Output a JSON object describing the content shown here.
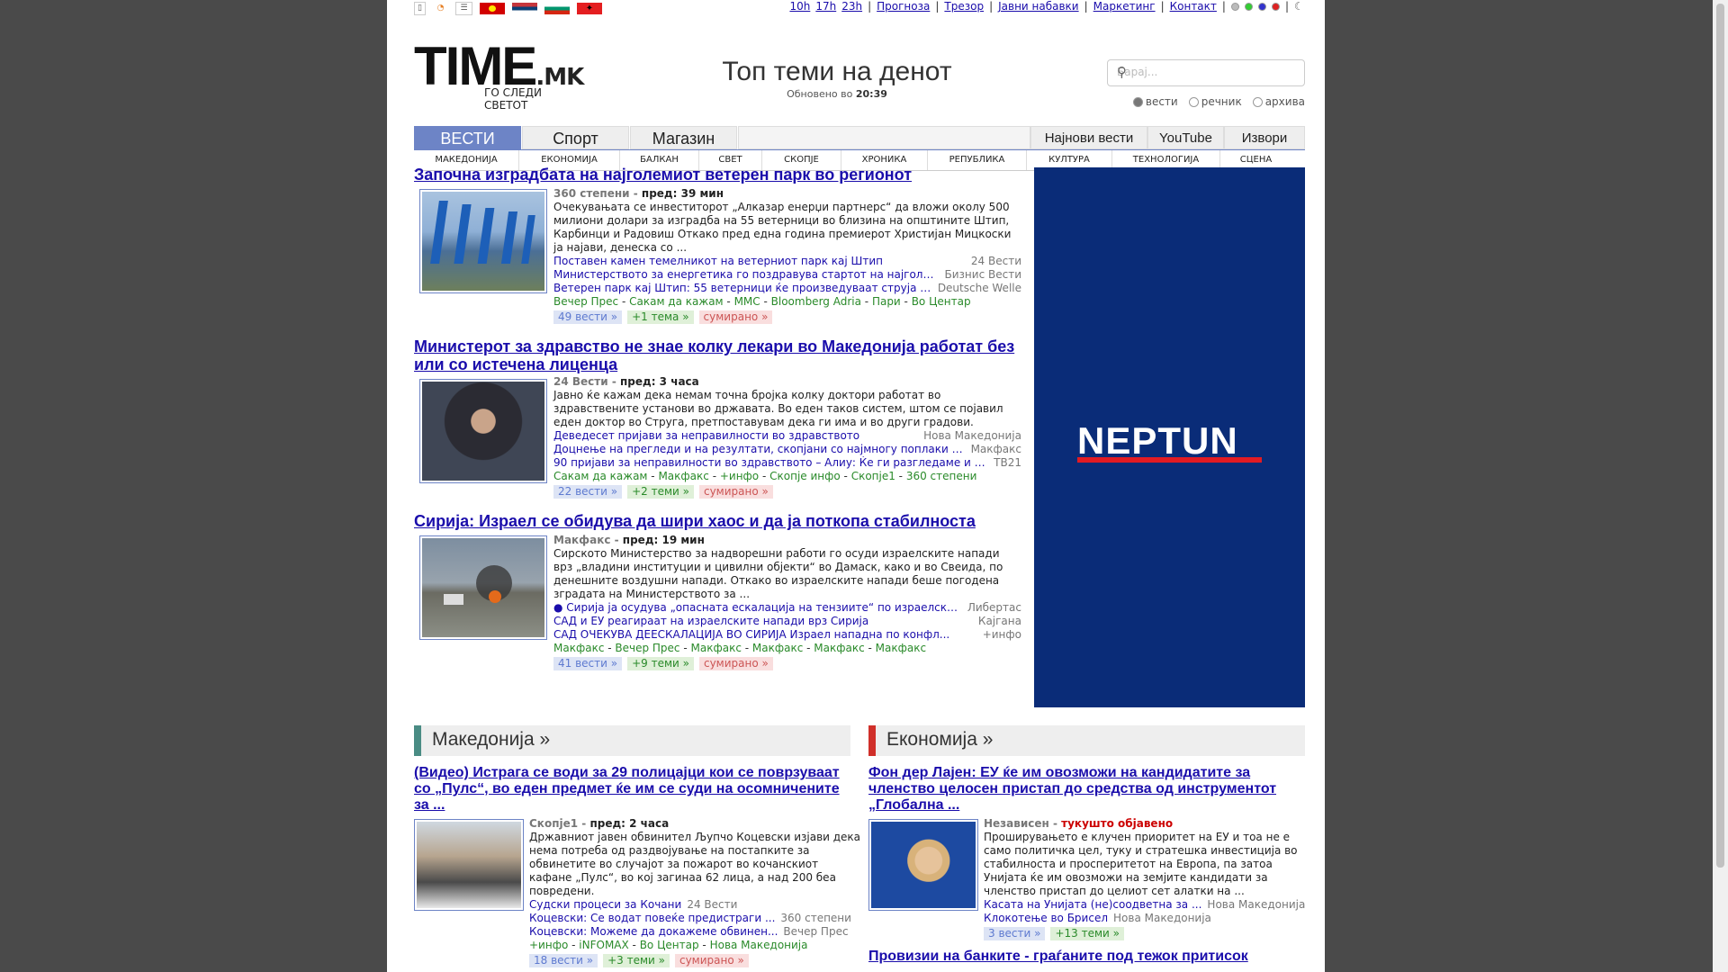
{
  "topbar": {
    "links": [
      "10h",
      "17h",
      "23h",
      "Прогноза",
      "Трезор",
      "Јавни набавки",
      "Маркетинг",
      "Контакт"
    ],
    "icons": [
      "mobile-icon",
      "rss-icon",
      "list-icon"
    ]
  },
  "header": {
    "logo_main": "TIME",
    "logo_mk": ".MK",
    "logo_tag": "ГО СЛЕДИ СВЕТОТ",
    "title": "Топ теми на денот",
    "updated_label": "Обновено во",
    "updated_time": "20:39",
    "search_placeholder": "Барај...",
    "radio": [
      "вести",
      "речник",
      "архива"
    ]
  },
  "tabs": [
    "ВЕСТИ",
    "Спорт",
    "Магазин",
    "Најнови вести",
    "YouTube",
    "Извори"
  ],
  "subtabs": [
    "МАКЕДОНИЈА",
    "ЕКОНОМИЈА",
    "БАЛКАН",
    "СВЕТ",
    "СКОПЈЕ",
    "ХРОНИКА",
    "РЕПУБЛИКА",
    "КУЛТУРА",
    "ТЕХНОЛОГИЈА",
    "СЦЕНА"
  ],
  "stories": [
    {
      "headline": "Започна изградбата на најголемиот ветерен парк во регионот",
      "source": "360 степени",
      "time": "пред: 39 мин",
      "text": "Очекувањата се инвеститорот „Алказар енерџи партнерс“ да вложи околу 500 милиони долари за изградба на 55 ветерници во близина на општините Штип, Карбинци и Радовиш Откако пред една година премиерот Христијан Мицкоски ја најави, денеска со ...",
      "related": [
        {
          "t": "Поставен камен темелникот на ветерниот парк кај Штип",
          "s": "24 Вести"
        },
        {
          "t": "Министерството за енергетика го поздравува стартот на најголем...",
          "s": "Бизнис Вести"
        },
        {
          "t": "Ветерен парк кај Штип: 55 ветерници ќе произведуваат струја за...",
          "s": "Deutsche Welle"
        }
      ],
      "sources": [
        "Вечер Прес",
        "Сакам да кажам",
        "МMC",
        "Bloomberg Adria",
        "Пари",
        "Во Центар"
      ],
      "b1": "49 вести »",
      "b2": "+1 тема »",
      "b3": "сумирано »"
    },
    {
      "headline": "Министерот за здравство не знае колку лекари во Македонија работат без или со истечена лиценца",
      "source": "24 Вести",
      "time": "пред: 3 часа",
      "text": "Јавно ќе кажам дека немам точна бројка колку доктори работат во здравствените установи во државата. Во еден таков систем, штом се појавил еден доктор во Струга, претпоставувам дека ги има и во други градови.",
      "related": [
        {
          "t": "Деведесет пријави за неправилности во здравството",
          "s": "Нова Македонија"
        },
        {
          "t": "Доцнење на прегледи и на резултати, скопјани со најмногу поплаки за...",
          "s": "Макфакс"
        },
        {
          "t": "90 пријави за неправилности во здравството – Алиу: Ќе ги разгледаме и к...",
          "s": "TB21"
        }
      ],
      "sources": [
        "Сакам да кажам",
        "Макфакс",
        "+инфо",
        "Скопје инфо",
        "Скопје1",
        "360 степени"
      ],
      "b1": "22 вести »",
      "b2": "+2 теми »",
      "b3": "сумирано »"
    },
    {
      "headline": "Сирија: Израел се обидува да шири хаос и да ја поткопа стабилноста",
      "source": "Макфакс",
      "time": "пред: 19 мин",
      "text": "Сирското Министерство за надворешни работи го осуди израелските напади врз „владини институции и цивилни објекти“ во Дамаск, како и во Свеида, по денешните воздушни напади. Откако во израелските напади беше погодена зградата на Министерството за ...",
      "related": [
        {
          "t": "● Сирија ја осудува „опасната ескалација на тензиите“ по израелскит...",
          "s": "Либертас"
        },
        {
          "t": "САД и ЕУ реагираат на израелските напади врз Сирија",
          "s": "Кајгана"
        },
        {
          "t": "САД ОЧЕКУВА ДЕЕСКАЛАЦИЈА ВО СИРИЈА Израел нападна по конфл...",
          "s": "+инфо"
        }
      ],
      "sources": [
        "Макфакс",
        "Вечер Прес",
        "Макфакс",
        "Макфакс",
        "Макфакс",
        "Макфакс"
      ],
      "b1": "41 вести »",
      "b2": "+9 теми »",
      "b3": "сумирано »"
    }
  ],
  "ad": {
    "brand": "NEPTUN"
  },
  "sections": [
    {
      "title": "Македонија »",
      "color": "#4a8c84",
      "headline": "(Видео) Истрага се води за 29 полицајци кои се поврзуваат со „Пулс“, во еден предмет ќе им се суди на осомничените за ...",
      "source": "Скопје1",
      "time": "пред: 2 часа",
      "text": "Државниот јавен обвинител Љупчо Коцевски изјави дека нема потреба од раздвојување на постапките за обвинетите во случајот за пожарот во кочанскиот кафане „Пулс“, во кој загинаа 62 лица, а над 200 беа повредени.",
      "related": [
        {
          "t": "Судски процеси за Кочани",
          "s": "24 Вести"
        },
        {
          "t": "Коцевски: Се водат повеќе предистраги ...",
          "s": "360 степени"
        },
        {
          "t": "Коцевски: Можеме да докажеме обвинен...",
          "s": "Вечер Прес"
        }
      ],
      "sources": [
        "+инфо",
        "iNFOMAX",
        "Во Центар",
        "Нова Македонија"
      ],
      "b1": "18 вести »",
      "b2": "+3 теми »",
      "b3": "сумирано »"
    },
    {
      "title": "Економија »",
      "color": "#d0302a",
      "headline": "Фон дер Лајен: ЕУ ќе им овозможи на кандидатите за членство целосен пристап до средства од инструментот „Глобална ...",
      "source": "Независен",
      "time": "тукушто објавено",
      "text": "Проширувањето е клучен приоритет на ЕУ и тоа не е само политичка цел, туку и стратешка инвестиција во стабилноста и просперитетот на Европа, па затоа Унијата ќе им овозможи на земјите кандидати за членство пристап до целиот сет алатки на ...",
      "related": [
        {
          "t": "Касата на Унијата (не)соодветна за ...",
          "s": "Нова Македонија"
        },
        {
          "t": "Клокотење во Брисел",
          "s": "Нова Македонија"
        }
      ],
      "sources": [],
      "b1": "3 вести »",
      "b2": "+13 теми »",
      "b3": "",
      "next_headline": "Провизии на банките - граѓаните под тежок притисок"
    }
  ]
}
